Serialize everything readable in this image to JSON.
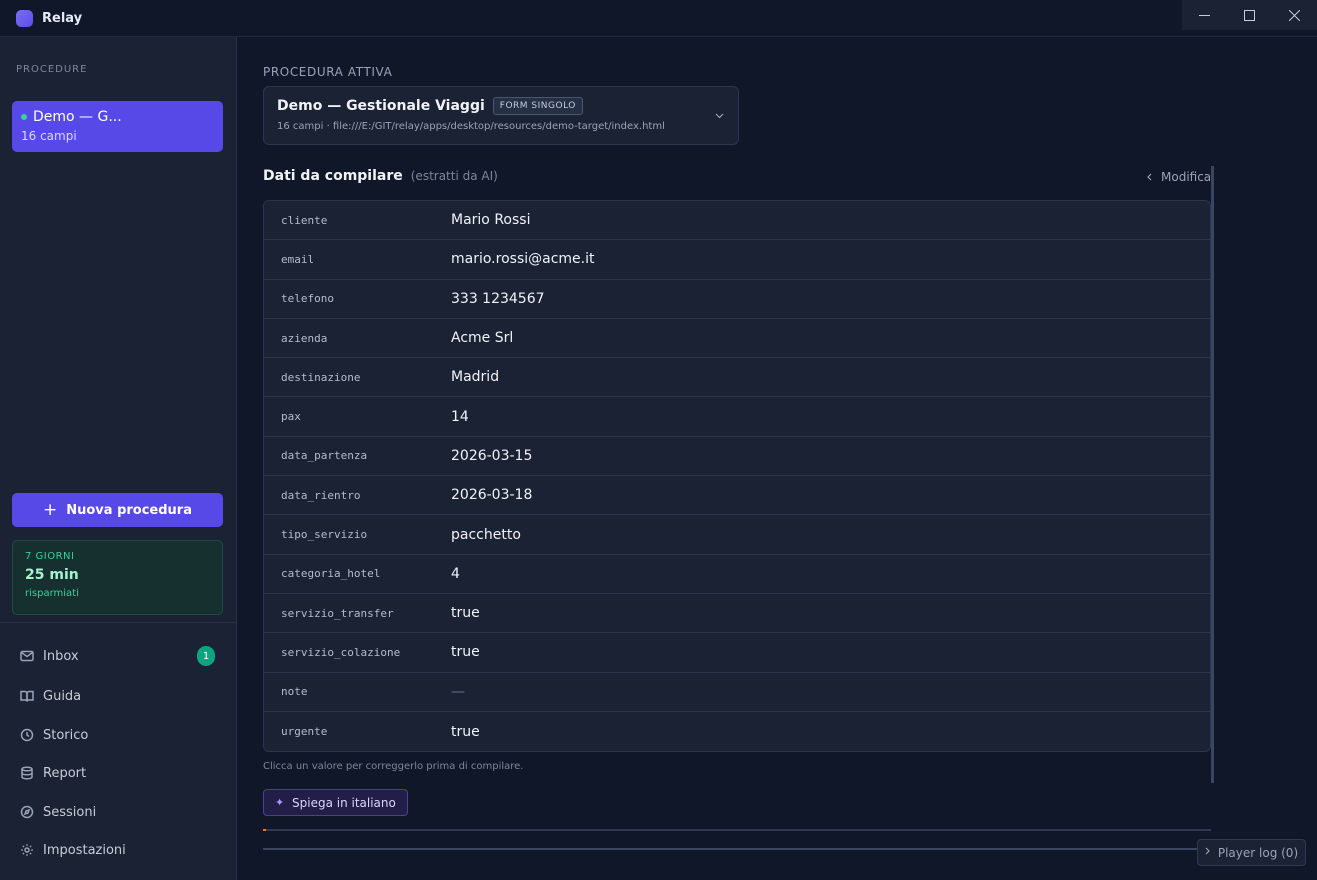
{
  "app": {
    "title": "Relay"
  },
  "window_controls": {
    "minimize": "—",
    "maximize": "☐",
    "close": "✕"
  },
  "sidebar": {
    "heading": "PROCEDURE",
    "procedures": [
      {
        "name": "Demo — G...",
        "fields": "16 campi",
        "status_color": "#34d399"
      }
    ],
    "new_button": {
      "icon": "+",
      "label": "Nuova procedura"
    },
    "stats": {
      "period": "7 GIORNI",
      "value": "25 min",
      "note": "risparmiati"
    },
    "nav": [
      {
        "label": "Inbox",
        "icon": "mail-icon",
        "badge": "1"
      },
      {
        "label": "Guida",
        "icon": "book-icon"
      },
      {
        "label": "Storico",
        "icon": "clock-icon"
      },
      {
        "label": "Report",
        "icon": "database-icon"
      },
      {
        "label": "Sessioni",
        "icon": "compass-icon"
      },
      {
        "label": "Impostazioni",
        "icon": "gear-icon"
      }
    ]
  },
  "main": {
    "active_label": "PROCEDURA ATTIVA",
    "procedure": {
      "name": "Demo — Gestionale Viaggi",
      "tag": "FORM SINGOLO",
      "path": "16 campi · file:///E:/GIT/relay/apps/desktop/resources/demo-target/index.html"
    },
    "section": {
      "title": "Dati da compilare",
      "subtitle": "(estratti da AI)",
      "modify": "Modifica"
    },
    "fields": [
      {
        "key": "cliente",
        "value": "Mario Rossi"
      },
      {
        "key": "email",
        "value": "mario.rossi@acme.it"
      },
      {
        "key": "telefono",
        "value": "333 1234567"
      },
      {
        "key": "azienda",
        "value": "Acme Srl"
      },
      {
        "key": "destinazione",
        "value": "Madrid"
      },
      {
        "key": "pax",
        "value": "14"
      },
      {
        "key": "data_partenza",
        "value": "2026-03-15"
      },
      {
        "key": "data_rientro",
        "value": "2026-03-18"
      },
      {
        "key": "tipo_servizio",
        "value": "pacchetto"
      },
      {
        "key": "categoria_hotel",
        "value": "4"
      },
      {
        "key": "servizio_transfer",
        "value": "true"
      },
      {
        "key": "servizio_colazione",
        "value": "true"
      },
      {
        "key": "note",
        "value": "—"
      },
      {
        "key": "urgente",
        "value": "true"
      }
    ],
    "hint": "Clicca un valore per correggerlo prima di compilare.",
    "explain_button": "Spiega in italiano",
    "player_log": "Player log (0)"
  },
  "colors": {
    "accent": "#5649e8",
    "success": "#34d399",
    "background": "#0f1729",
    "sidebar": "#1a2234"
  }
}
